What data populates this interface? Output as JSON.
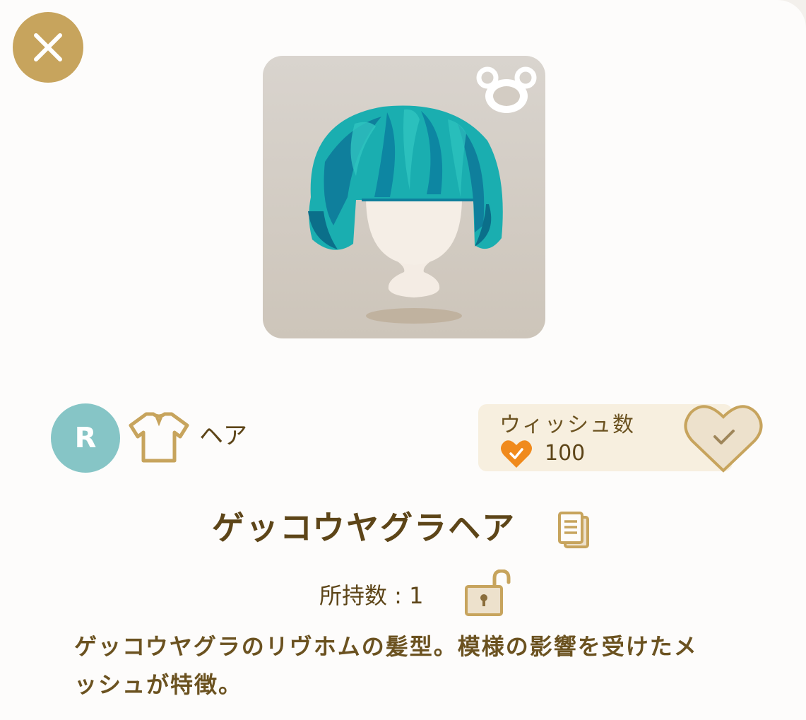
{
  "close": {
    "icon": "close-icon"
  },
  "item": {
    "name": "ゲッコウヤグラヘア",
    "rarity": "R",
    "category": "ヘア",
    "owned_label": "所持数 : 1",
    "description": "ゲッコウヤグラのリヴホムの髪型。模様の影響を受けたメッシュが特徴。"
  },
  "wish": {
    "title": "ウィッシュ数",
    "count": "100"
  },
  "colors": {
    "accent": "#c7a45d",
    "text": "#5d4518",
    "rarity_bg": "#86c5c6",
    "hair": "#1aaeb0",
    "wish_bg": "#f7efdf"
  }
}
